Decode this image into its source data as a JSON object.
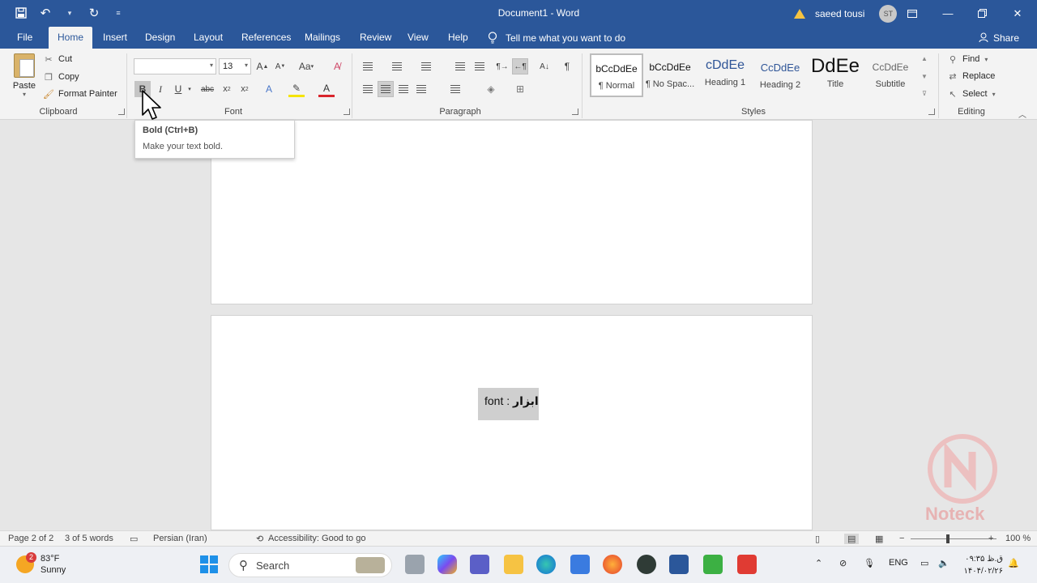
{
  "titlebar": {
    "title": "Document1 - Word",
    "user_name": "saeed tousi",
    "avatar_initials": "ST",
    "bg_color": "#2b579a"
  },
  "tabs": [
    {
      "label": "File"
    },
    {
      "label": "Home"
    },
    {
      "label": "Insert"
    },
    {
      "label": "Design"
    },
    {
      "label": "Layout"
    },
    {
      "label": "References"
    },
    {
      "label": "Mailings"
    },
    {
      "label": "Review"
    },
    {
      "label": "View"
    },
    {
      "label": "Help"
    }
  ],
  "tellme": "Tell me what you want to do",
  "share": "Share",
  "clipboard": {
    "paste": "Paste",
    "cut": "Cut",
    "copy": "Copy",
    "format_painter": "Format Painter",
    "label": "Clipboard"
  },
  "font": {
    "name_value": "",
    "size_value": "13",
    "label": "Font"
  },
  "paragraph": {
    "label": "Paragraph"
  },
  "styles": {
    "label": "Styles",
    "items": [
      {
        "sample": "bCcDdEe",
        "name": "¶ Normal"
      },
      {
        "sample": "bCcDdEe",
        "name": "¶ No Spac..."
      },
      {
        "sample": "cDdEe",
        "name": "Heading 1"
      },
      {
        "sample": "CcDdEe",
        "name": "Heading 2"
      },
      {
        "sample": "DdEe",
        "name": "Title"
      },
      {
        "sample": "CcDdEe",
        "name": "Subtitle"
      }
    ]
  },
  "editing": {
    "find": "Find",
    "replace": "Replace",
    "select": "Select",
    "label": "Editing"
  },
  "tooltip": {
    "title": "Bold (Ctrl+B)",
    "desc": "Make your text bold."
  },
  "document": {
    "selected_text_plain": "font : ",
    "selected_text_bold": "ابزار"
  },
  "watermark": {
    "text": "Noteck"
  },
  "status": {
    "page": "Page 2 of 2",
    "words": "3 of 5 words",
    "language": "Persian (Iran)",
    "accessibility": "Accessibility: Good to go",
    "zoom": "100 %"
  },
  "taskbar": {
    "temp": "83°F",
    "condition": "Sunny",
    "weather_badge": "2",
    "search": "Search",
    "lang": "ENG",
    "time": "۰۹:۳۵ ق.ظ",
    "date": "۱۴۰۴/۰۲/۲۶"
  }
}
